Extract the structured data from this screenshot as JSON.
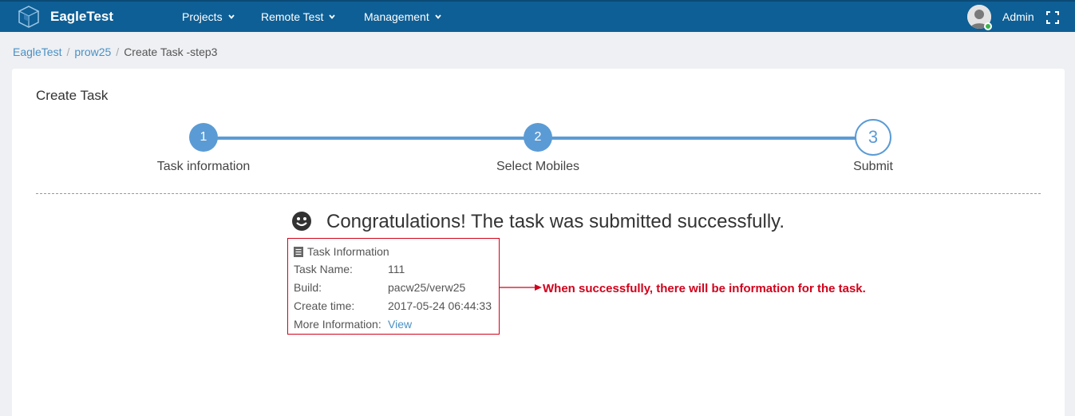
{
  "header": {
    "brand": "EagleTest",
    "nav": [
      {
        "label": "Projects"
      },
      {
        "label": "Remote Test"
      },
      {
        "label": "Management"
      }
    ],
    "user_name": "Admin",
    "accent": "#0e5f95"
  },
  "breadcrumb": {
    "items": [
      "EagleTest",
      "prow25"
    ],
    "current": "Create Task -step3"
  },
  "panel": {
    "title": "Create Task"
  },
  "steps": [
    {
      "number": "1",
      "label": "Task information",
      "state": "done"
    },
    {
      "number": "2",
      "label": "Select Mobiles",
      "state": "done"
    },
    {
      "number": "3",
      "label": "Submit",
      "state": "current"
    }
  ],
  "result": {
    "message": "Congratulations! The task was submitted successfully.",
    "icon": "smile-icon"
  },
  "task_info": {
    "heading": "Task Information",
    "rows": [
      {
        "label": "Task Name:",
        "value": "111"
      },
      {
        "label": "Build:",
        "value": "pacw25/verw25"
      },
      {
        "label": "Create time:",
        "value": "2017-05-24 06:44:33"
      },
      {
        "label": "More Information:",
        "value": "View"
      }
    ]
  },
  "annotation": {
    "text": "When successfully, there will be information for the task.",
    "color": "#d0021b"
  }
}
